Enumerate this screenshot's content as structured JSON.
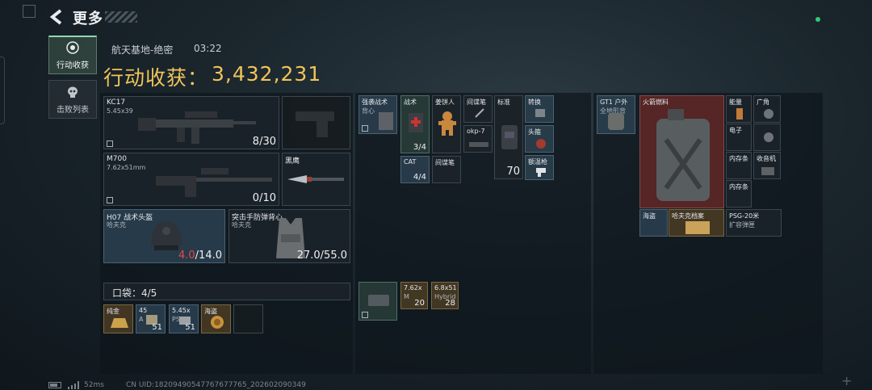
{
  "header": {
    "title": "更多"
  },
  "tabs": [
    {
      "label": "行动收获",
      "active": true
    },
    {
      "label": "击败列表",
      "active": false
    }
  ],
  "raid": {
    "map": "航天基地-绝密",
    "time": "03:22"
  },
  "loot": {
    "label": "行动收获：",
    "value": "3,432,231"
  },
  "weapons": [
    {
      "name": "KC17",
      "caliber": "5.45x39",
      "ammo": "8/30"
    },
    {
      "name": "M700",
      "caliber": "7.62x51mm",
      "ammo": "0/10"
    }
  ],
  "melee": {
    "name": "黑鹰"
  },
  "helmet": {
    "name": "H07 战术头盔",
    "brand": "哈夫克",
    "dur_current": "4.0",
    "dur_max": "/14.0"
  },
  "armor": {
    "name": "突击手防弹背心",
    "brand": "哈夫克",
    "durability": "27.0/55.0"
  },
  "pocket": {
    "label": "口袋：4/5",
    "items": [
      {
        "name": "纯金",
        "count": ""
      },
      {
        "name": "45",
        "sub": "A",
        "count": "51"
      },
      {
        "name": "5.45x",
        "sub": "PS",
        "count": "51"
      },
      {
        "name": "海盗",
        "count": ""
      }
    ]
  },
  "vest": {
    "items": [
      {
        "name": "强袭战术",
        "sub": "背心"
      },
      {
        "name": "战术",
        "count": "3/4"
      },
      {
        "name": "姜饼人"
      },
      {
        "name": "间谍笔"
      },
      {
        "name": "标准"
      },
      {
        "name": "转换"
      },
      {
        "name": "okp-7"
      },
      {
        "name": "头箍"
      },
      {
        "name": "CAT",
        "count": "4/4"
      },
      {
        "name": "间谍笔"
      },
      {
        "name": "",
        "count": "70"
      },
      {
        "name": "额温枪"
      }
    ],
    "ammo": [
      {
        "name": "7.62x",
        "sub": "M",
        "count": "20"
      },
      {
        "name": "6.8x51",
        "sub": "Hybrid",
        "count": "28"
      }
    ]
  },
  "backpack": {
    "items": [
      {
        "name": "GT1 户外",
        "sub": "全地形背"
      },
      {
        "name": "火箭燃料"
      },
      {
        "name": "能量"
      },
      {
        "name": "广角"
      },
      {
        "name": "电子"
      },
      {
        "name": "内存条"
      },
      {
        "name": "收音机"
      },
      {
        "name": "内存条"
      },
      {
        "name": "海盗"
      },
      {
        "name": "哈夫克档案"
      },
      {
        "name": "PSG-20米",
        "sub": "扩容弹匣"
      }
    ]
  },
  "footer": {
    "ping": "52ms",
    "uid": "CN UID:18209490547767677765_202602090349"
  },
  "colors": {
    "loot_gold": "#f1c45a",
    "durability_red": "#e34b4b",
    "status_green": "#2ecc71"
  }
}
